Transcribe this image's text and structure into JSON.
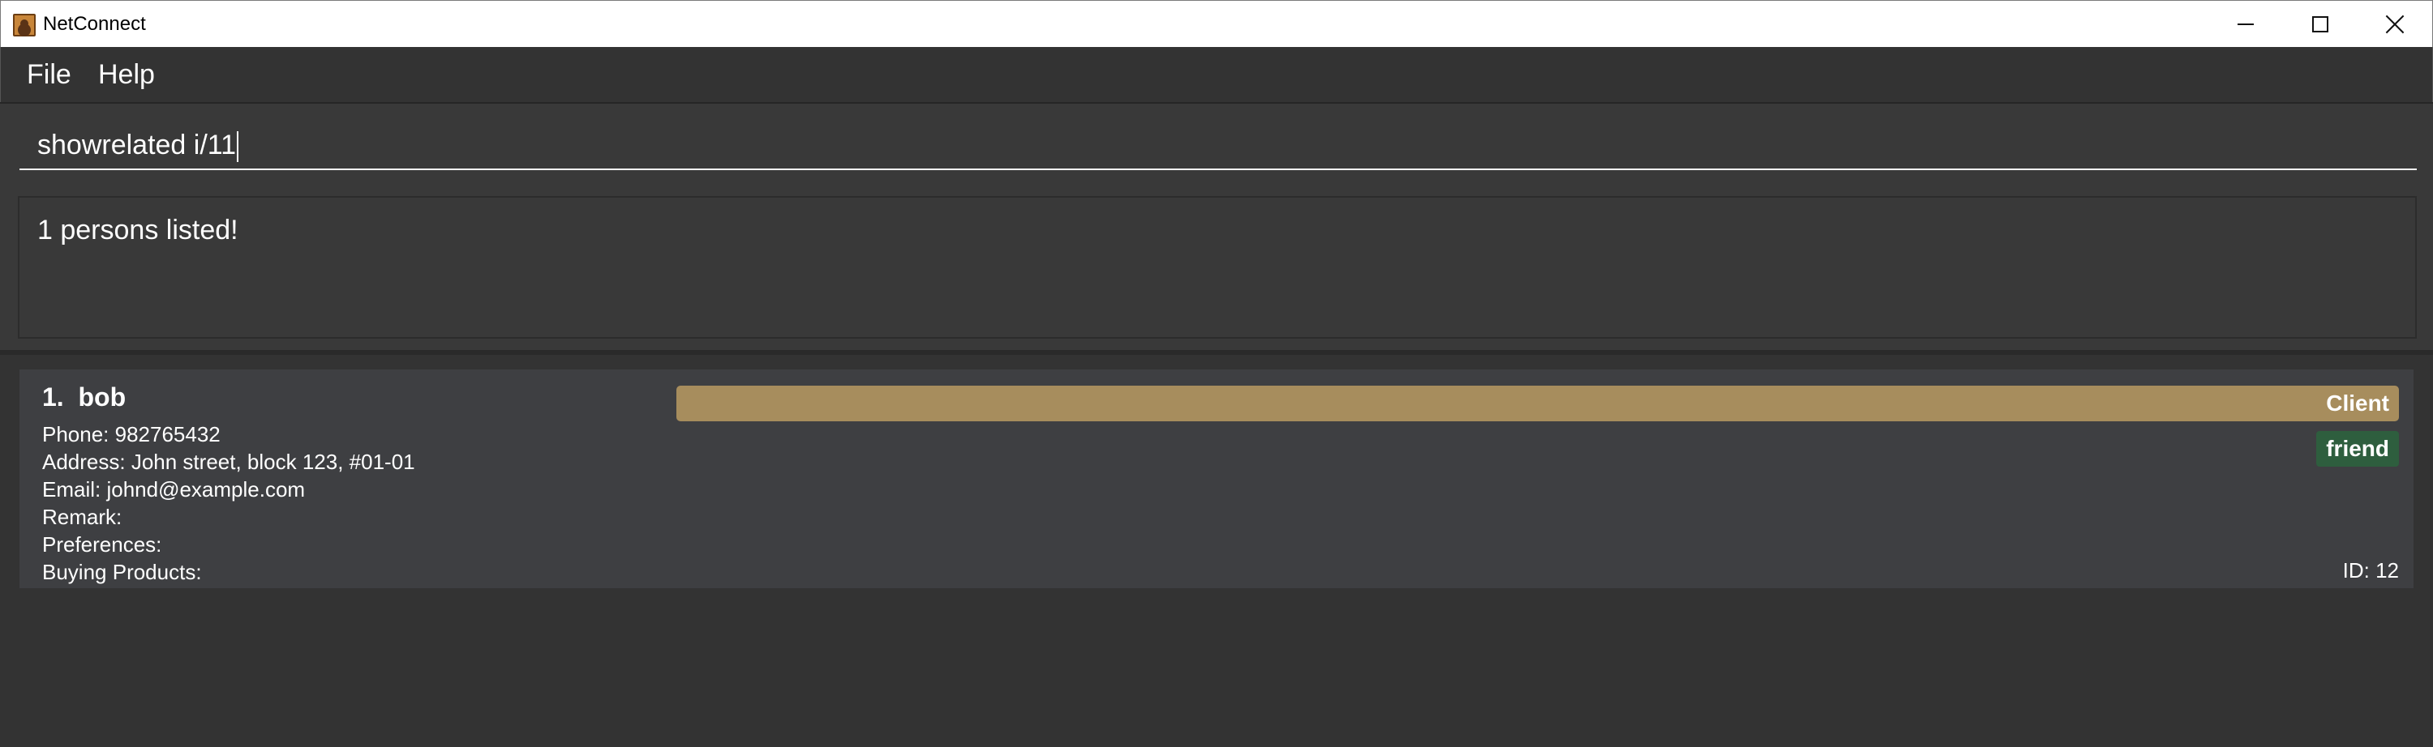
{
  "window": {
    "title": "NetConnect",
    "icon": "contact-book-icon"
  },
  "menu": {
    "file": "File",
    "help": "Help"
  },
  "command": {
    "value": "showrelated i/11"
  },
  "result": {
    "message": "1 persons listed!"
  },
  "persons": [
    {
      "index": "1.",
      "name": "bob",
      "phone": "Phone: 982765432",
      "address": "Address: John street, block 123, #01-01",
      "email": "Email: johnd@example.com",
      "remark": "Remark:",
      "preferences": "Preferences:",
      "buying_products": "Buying Products:",
      "role_tag": "Client",
      "tag": "friend",
      "id": "ID: 12"
    }
  ],
  "colors": {
    "background": "#333333",
    "card": "#3e3f42",
    "client_tag": "#a78d5d",
    "friend_tag": "#2e5e3e"
  }
}
